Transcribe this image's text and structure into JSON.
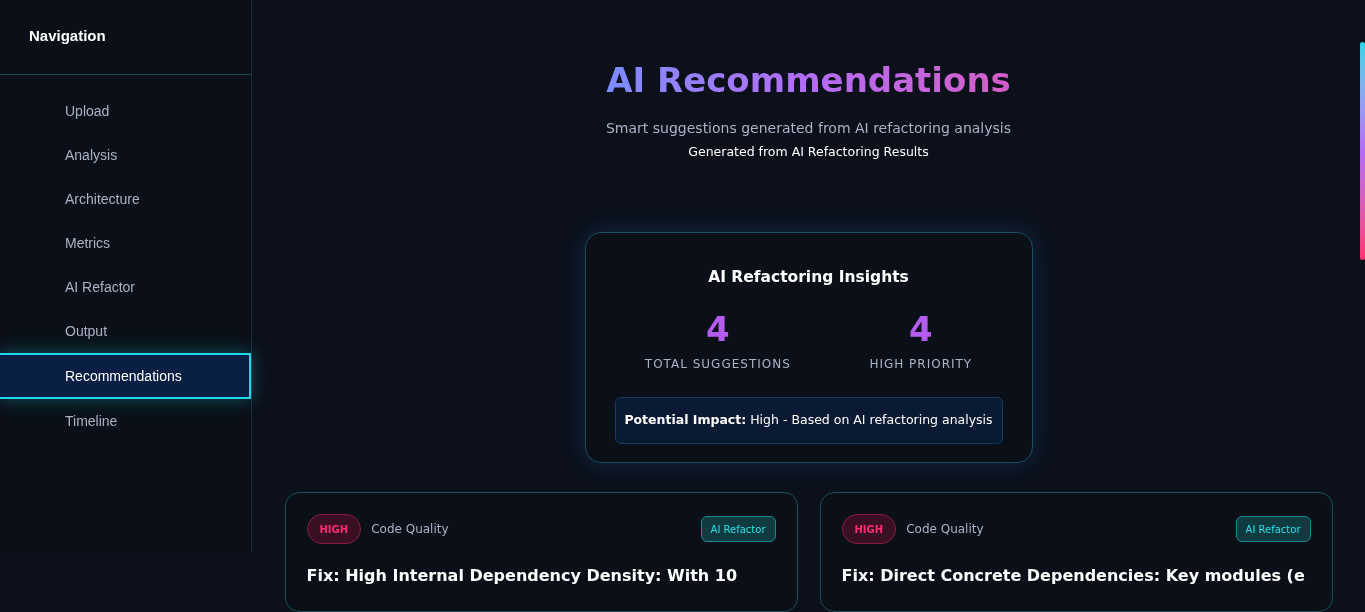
{
  "sidebar": {
    "title": "Navigation",
    "items": [
      {
        "label": "Upload",
        "selected": false
      },
      {
        "label": "Analysis",
        "selected": false
      },
      {
        "label": "Architecture",
        "selected": false
      },
      {
        "label": "Metrics",
        "selected": false
      },
      {
        "label": "AI Refactor",
        "selected": false
      },
      {
        "label": "Output",
        "selected": false
      },
      {
        "label": "Recommendations",
        "selected": true
      },
      {
        "label": "Timeline",
        "selected": false
      }
    ]
  },
  "header": {
    "title": "AI Recommendations",
    "subtitle": "Smart suggestions generated from AI refactoring analysis",
    "source": "Generated from AI Refactoring Results"
  },
  "insights": {
    "title": "AI Refactoring Insights",
    "stats": [
      {
        "value": "4",
        "label": "TOTAL SUGGESTIONS"
      },
      {
        "value": "4",
        "label": "HIGH PRIORITY"
      }
    ],
    "impact": "**Potential Impact:** High - Based on AI refactoring analysis"
  },
  "cards": [
    {
      "priority": "HIGH",
      "kind": "high",
      "category": "Code Quality",
      "source": "AI Refactor",
      "title": "Fix: High Internal Dependency Density: With 10"
    },
    {
      "priority": "HIGH",
      "kind": "high",
      "category": "Code Quality",
      "source": "AI Refactor",
      "title": "Fix: Direct Concrete Dependencies: Key modules (e"
    }
  ]
}
